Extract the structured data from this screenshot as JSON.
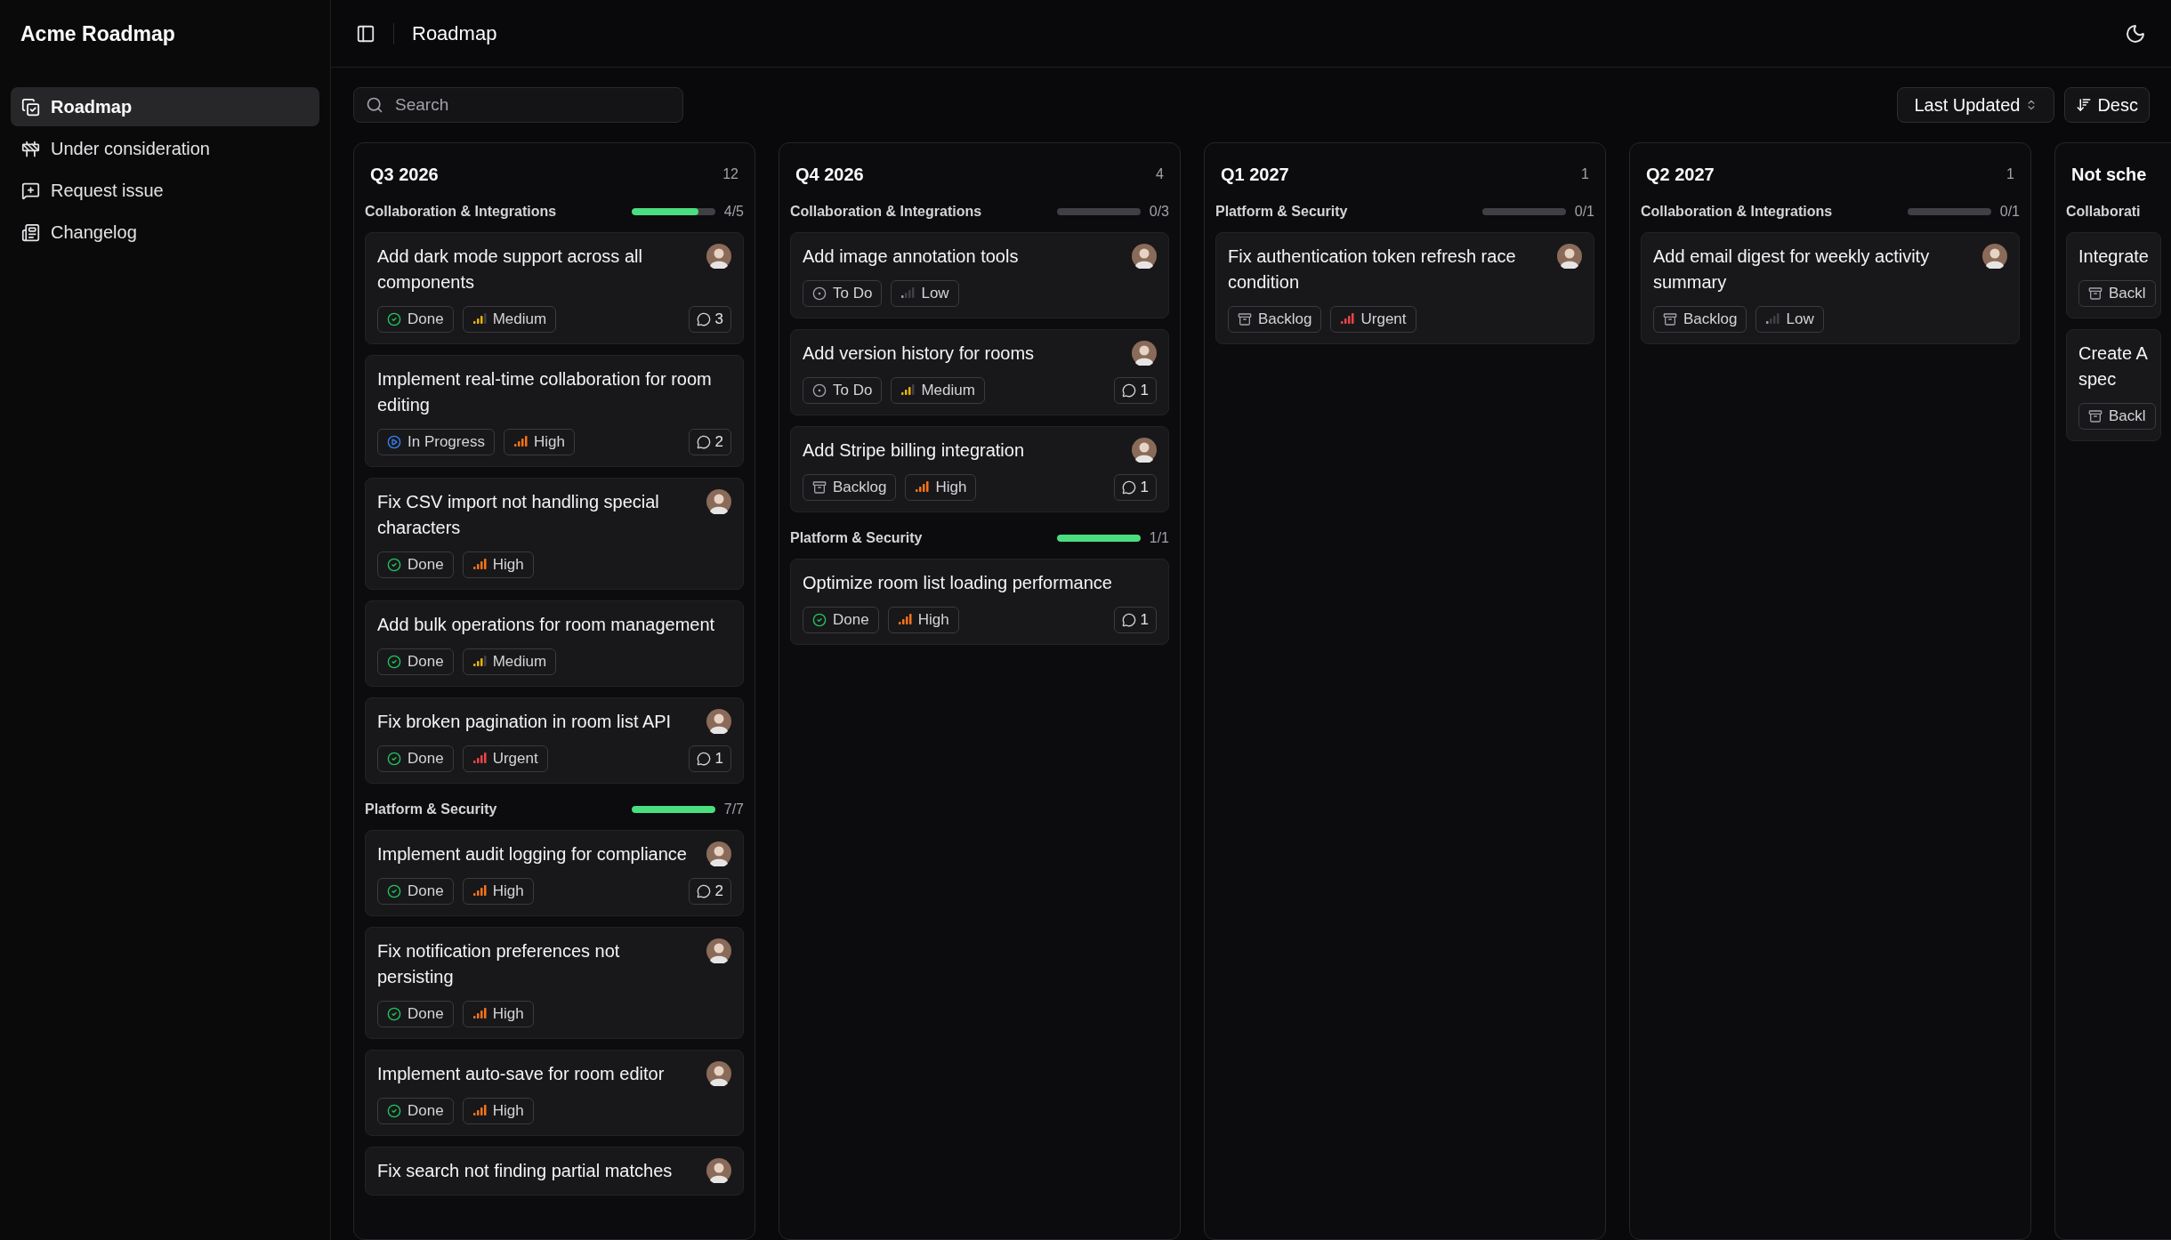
{
  "app_title": "Acme Roadmap",
  "sidebar": {
    "items": [
      {
        "label": "Roadmap",
        "selected": true
      },
      {
        "label": "Under consideration",
        "selected": false
      },
      {
        "label": "Request issue",
        "selected": false
      },
      {
        "label": "Changelog",
        "selected": false
      }
    ]
  },
  "header": {
    "title": "Roadmap"
  },
  "search": {
    "placeholder": "Search"
  },
  "sort": {
    "field": "Last Updated",
    "order": "Desc"
  },
  "columns": [
    {
      "title": "Q3 2026",
      "count": "12",
      "groups": [
        {
          "label": "Collaboration & Integrations",
          "level": 0.8,
          "progress": "4/5",
          "cards": [
            {
              "title": "Add dark mode support across all components",
              "avatar": true,
              "status": {
                "kind": "done",
                "label": "Done"
              },
              "priority": {
                "kind": "medium",
                "label": "Medium"
              },
              "comments": "3"
            },
            {
              "title": "Implement real-time collaboration for room editing",
              "avatar": false,
              "status": {
                "kind": "in_progress",
                "label": "In Progress"
              },
              "priority": {
                "kind": "high",
                "label": "High"
              },
              "comments": "2"
            },
            {
              "title": "Fix CSV import not handling special characters",
              "avatar": true,
              "status": {
                "kind": "done",
                "label": "Done"
              },
              "priority": {
                "kind": "high",
                "label": "High"
              }
            },
            {
              "title": "Add bulk operations for room management",
              "avatar": false,
              "status": {
                "kind": "done",
                "label": "Done"
              },
              "priority": {
                "kind": "medium",
                "label": "Medium"
              }
            },
            {
              "title": "Fix broken pagination in room list API",
              "avatar": true,
              "status": {
                "kind": "done",
                "label": "Done"
              },
              "priority": {
                "kind": "urgent",
                "label": "Urgent"
              },
              "comments": "1"
            }
          ]
        },
        {
          "label": "Platform & Security",
          "level": 1,
          "progress": "7/7",
          "cards": [
            {
              "title": "Implement audit logging for compliance",
              "avatar": true,
              "status": {
                "kind": "done",
                "label": "Done"
              },
              "priority": {
                "kind": "high",
                "label": "High"
              },
              "comments": "2"
            },
            {
              "title": "Fix notification preferences not persisting",
              "avatar": true,
              "status": {
                "kind": "done",
                "label": "Done"
              },
              "priority": {
                "kind": "high",
                "label": "High"
              }
            },
            {
              "title": "Implement auto-save for room editor",
              "avatar": true,
              "status": {
                "kind": "done",
                "label": "Done"
              },
              "priority": {
                "kind": "high",
                "label": "High"
              }
            },
            {
              "title": "Fix search not finding partial matches",
              "avatar": true
            }
          ]
        }
      ]
    },
    {
      "title": "Q4 2026",
      "count": "4",
      "groups": [
        {
          "label": "Collaboration & Integrations",
          "level": 0,
          "progress": "0/3",
          "cards": [
            {
              "title": "Add image annotation tools",
              "avatar": true,
              "status": {
                "kind": "todo",
                "label": "To Do"
              },
              "priority": {
                "kind": "low",
                "label": "Low"
              }
            },
            {
              "title": "Add version history for rooms",
              "avatar": true,
              "status": {
                "kind": "todo",
                "label": "To Do"
              },
              "priority": {
                "kind": "medium",
                "label": "Medium"
              },
              "comments": "1"
            },
            {
              "title": "Add Stripe billing integration",
              "avatar": true,
              "status": {
                "kind": "backlog",
                "label": "Backlog"
              },
              "priority": {
                "kind": "high",
                "label": "High"
              },
              "comments": "1"
            }
          ]
        },
        {
          "label": "Platform & Security",
          "level": 1,
          "progress": "1/1",
          "cards": [
            {
              "title": "Optimize room list loading performance",
              "avatar": false,
              "status": {
                "kind": "done",
                "label": "Done"
              },
              "priority": {
                "kind": "high",
                "label": "High"
              },
              "comments": "1"
            }
          ]
        }
      ]
    },
    {
      "title": "Q1 2027",
      "count": "1",
      "groups": [
        {
          "label": "Platform & Security",
          "level": 0,
          "progress": "0/1",
          "cards": [
            {
              "title": "Fix authentication token refresh race condition",
              "avatar": true,
              "status": {
                "kind": "backlog",
                "label": "Backlog"
              },
              "priority": {
                "kind": "urgent",
                "label": "Urgent"
              }
            }
          ]
        }
      ]
    },
    {
      "title": "Q2 2027",
      "count": "1",
      "groups": [
        {
          "label": "Collaboration & Integrations",
          "level": 0,
          "progress": "0/1",
          "cards": [
            {
              "title": "Add email digest for weekly activity summary",
              "avatar": true,
              "status": {
                "kind": "backlog",
                "label": "Backlog"
              },
              "priority": {
                "kind": "low",
                "label": "Low"
              }
            }
          ]
        }
      ]
    },
    {
      "title": "Not sche",
      "partial": true,
      "groups": [
        {
          "label": "Collaborati",
          "cards": [
            {
              "title": "Integrate",
              "status": {
                "kind": "backlog",
                "label": "Backl"
              }
            },
            {
              "title": "Create A spec",
              "status": {
                "kind": "backlog",
                "label": "Backl"
              }
            }
          ]
        }
      ]
    }
  ]
}
